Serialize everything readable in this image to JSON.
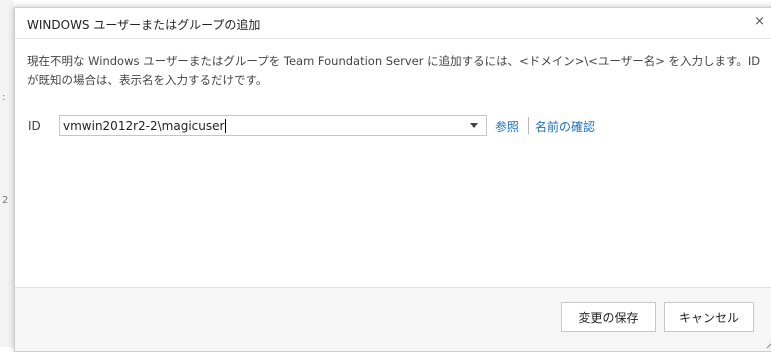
{
  "dialog": {
    "title": "WINDOWS ユーザーまたはグループの追加",
    "close_glyph": "×",
    "description": "現在不明な Windows ユーザーまたはグループを Team Foundation Server に追加するには、<ドメイン>\\<ユーザー名> を入力します。ID が既知の場合は、表示名を入力するだけです。",
    "id_label": "ID",
    "id_value": "vmwin2012r2-2\\magicuser",
    "browse_link": "参照",
    "check_name_link": "名前の確認",
    "save_button": "変更の保存",
    "cancel_button": "キャンセル"
  },
  "background": {
    "char_1": ":",
    "char_2": "2"
  },
  "colors": {
    "link": "#1e6fb8",
    "footer_bg": "#f6f6f6",
    "border": "#cfcfcf"
  }
}
